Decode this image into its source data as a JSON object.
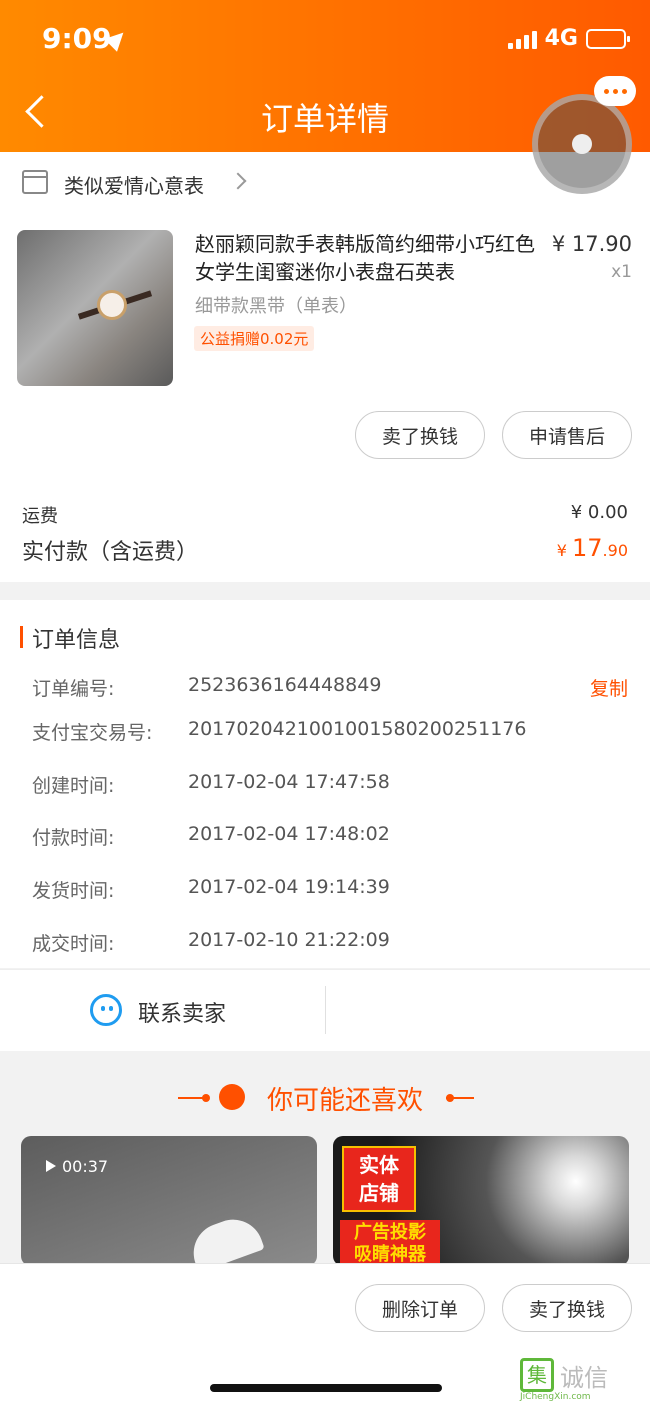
{
  "status_bar": {
    "time": "9:09",
    "network": "4G"
  },
  "header": {
    "title": "订单详情"
  },
  "shop": {
    "name": "类似爱情心意表"
  },
  "product": {
    "title": "赵丽颖同款手表韩版简约细带小巧红色女学生闺蜜迷你小表盘石英表",
    "price": "¥ 17.90",
    "quantity": "x1",
    "spec": "细带款黑带（单表）",
    "badge": "公益捐赠0.02元",
    "actions": [
      "卖了换钱",
      "申请售后"
    ]
  },
  "summary": {
    "shipping_label": "运费",
    "shipping_value": "¥ 0.00",
    "paid_label": "实付款（含运费）",
    "paid_currency": "¥ ",
    "paid_int": "17",
    "paid_dec": ".90"
  },
  "order_info": {
    "title": "订单信息",
    "copy_label": "复制",
    "rows": [
      {
        "label": "订单编号:",
        "value": "2523636164448849"
      },
      {
        "label": "支付宝交易号:",
        "value": "2017020421001001580200251176"
      },
      {
        "label": "创建时间:",
        "value": "2017-02-04 17:47:58"
      },
      {
        "label": "付款时间:",
        "value": "2017-02-04 17:48:02"
      },
      {
        "label": "发货时间:",
        "value": "2017-02-04 19:14:39"
      },
      {
        "label": "成交时间:",
        "value": "2017-02-10 21:22:09"
      }
    ]
  },
  "contact": {
    "label": "联系卖家"
  },
  "recommend": {
    "title": "你可能还喜欢",
    "video_time": "00:37",
    "ad_line1": "实体",
    "ad_line2": "店铺",
    "ad_line3": "广告投影",
    "ad_line4": "吸睛神器"
  },
  "bottom_actions": [
    "删除订单",
    "卖了换钱"
  ],
  "watermark": {
    "mark": "集",
    "text": "诚信",
    "sub": "JiChengXin.com"
  },
  "colors": {
    "accent": "#ff5000",
    "header_start": "#ff8a00",
    "header_end": "#ff5a00",
    "contact_blue": "#1f9cf0"
  }
}
